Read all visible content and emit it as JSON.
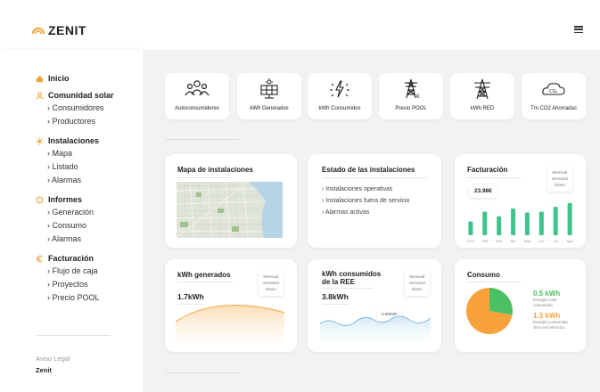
{
  "brand": {
    "name": "ZENIT"
  },
  "sidebar": {
    "home_label": "Inicio",
    "groups": [
      {
        "label": "Comunidad solar",
        "items": [
          "Consumidores",
          "Productores"
        ]
      },
      {
        "label": "Instalaciones",
        "items": [
          "Mapa",
          "Listado",
          "Alarmas"
        ]
      },
      {
        "label": "Informes",
        "items": [
          "Generación",
          "Consumo",
          "Alarmas"
        ]
      },
      {
        "label": "Facturación",
        "items": [
          "Flujo de caja",
          "Proyectos",
          "Precio POOL"
        ]
      }
    ],
    "legal_label": "Aviso Legal",
    "company_label": "Zenit"
  },
  "stats": [
    {
      "label": "Autoconsumidores",
      "icon": "people-icon"
    },
    {
      "label": "kWh Generados",
      "icon": "solar-panel-icon"
    },
    {
      "label": "kWh Consumidos",
      "icon": "lightning-icon"
    },
    {
      "label": "Precio POOL",
      "icon": "pylon-euro-icon"
    },
    {
      "label": "kWh RED",
      "icon": "power-tower-icon"
    },
    {
      "label": "Tm CO2 Ahorradas",
      "icon": "co2-cloud-icon"
    }
  ],
  "map_card": {
    "title": "Mapa de instalaciones"
  },
  "status_card": {
    "title": "Estado de las instalaciones",
    "items": [
      "Instalaciones operativas",
      "Instalaciones fuera de servicio",
      "Alarmas activas"
    ]
  },
  "billing_card": {
    "title": "Facturación",
    "value": "23.98€",
    "periods": [
      "Mensual",
      "Semanal",
      "Diario"
    ],
    "months": [
      "Ene",
      "Feb",
      "Mar",
      "Abr",
      "May",
      "Jun",
      "Jul",
      "Ago"
    ],
    "bar_levels": [
      0.35,
      0.6,
      0.48,
      0.68,
      0.58,
      0.6,
      0.72,
      0.82
    ],
    "accent": "#3ec38a"
  },
  "generated_card": {
    "title": "kWh generados",
    "value": "1.7kWh",
    "periods": [
      "Mensual",
      "Semanal",
      "Diario"
    ],
    "accent": "#f5b35f"
  },
  "consumed_card": {
    "title_line1": "kWh consumidos",
    "title_line2": "de la REE",
    "value": "3.8kWh",
    "tooltip": "0.88kWh",
    "periods": [
      "Mensual",
      "Semanal",
      "Diario"
    ],
    "accent": "#9cc9ea"
  },
  "consumption_card": {
    "title": "Consumo",
    "legend": [
      {
        "value": "0.5 kWh",
        "label1": "Energía solar",
        "label2": "consumida",
        "color": "#4cc163"
      },
      {
        "value": "1.3 kWh",
        "label1": "Energía consumida",
        "label2": "de la red eléctrica",
        "color": "#f7a23a"
      }
    ],
    "chart_data": {
      "type": "pie",
      "categories": [
        "Energía solar consumida",
        "Energía consumida de la red eléctrica"
      ],
      "values": [
        0.5,
        1.3
      ]
    }
  }
}
